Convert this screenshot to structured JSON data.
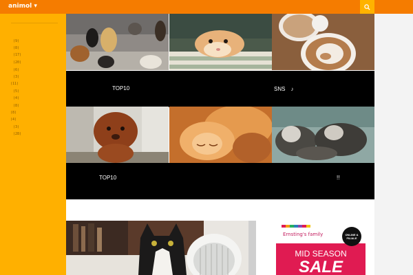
{
  "brand": "animol ",
  "sidebar": {
    "counts": [
      "(9)",
      "(8)",
      "(17)",
      "(20)",
      "(6)",
      "(3)",
      "(11)",
      "(5)",
      "(4)",
      "(8)",
      "(8)",
      "(4)",
      "(3)",
      "(28)",
      "(75)"
    ]
  },
  "captions": [
    {
      "left": "TOP10",
      "right": "SNS　♪"
    },
    {
      "left": "TOP10",
      "right": "!!"
    }
  ],
  "ad": {
    "brand": "Ernsting's family",
    "badge": "ONLINE & FILIALE",
    "headline": "MID SEASON",
    "sale": "SALE"
  },
  "colors": {
    "topbar": "#f57c00",
    "sidebar": "#ffb000",
    "search": "#ffb300"
  }
}
